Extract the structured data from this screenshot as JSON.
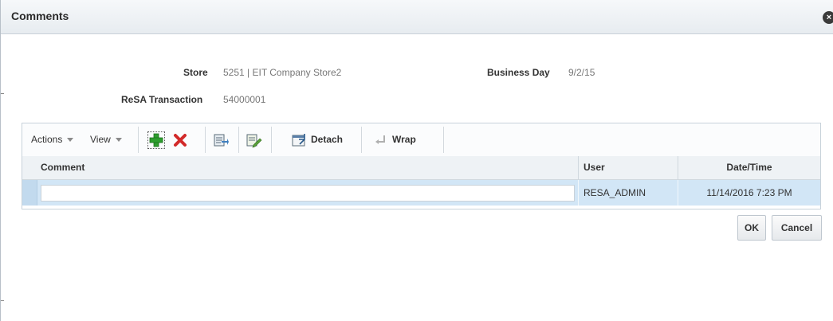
{
  "dialog": {
    "title": "Comments",
    "close_icon": "close-icon"
  },
  "fields": {
    "store_label": "Store",
    "store_value": "5251 | EIT Company Store2",
    "business_day_label": "Business Day",
    "business_day_value": "9/2/15",
    "resa_transaction_label": "ReSA Transaction",
    "resa_transaction_value": "54000001"
  },
  "toolbar": {
    "actions_label": "Actions",
    "view_label": "View",
    "add_icon": "add-plus-icon",
    "delete_icon": "delete-x-icon",
    "export_icon": "export-icon",
    "edit_icon": "edit-icon",
    "detach_label": "Detach",
    "wrap_label": "Wrap"
  },
  "table": {
    "columns": [
      "Comment",
      "User",
      "Date/Time"
    ],
    "rows": [
      {
        "comment": "",
        "user": "RESA_ADMIN",
        "datetime": "11/14/2016 7:23 PM"
      }
    ]
  },
  "buttons": {
    "ok_label": "OK",
    "cancel_label": "Cancel"
  },
  "colors": {
    "selected_row": "#d2e6f6",
    "add_green": "#2e9e2e",
    "delete_red": "#d22a2a"
  }
}
